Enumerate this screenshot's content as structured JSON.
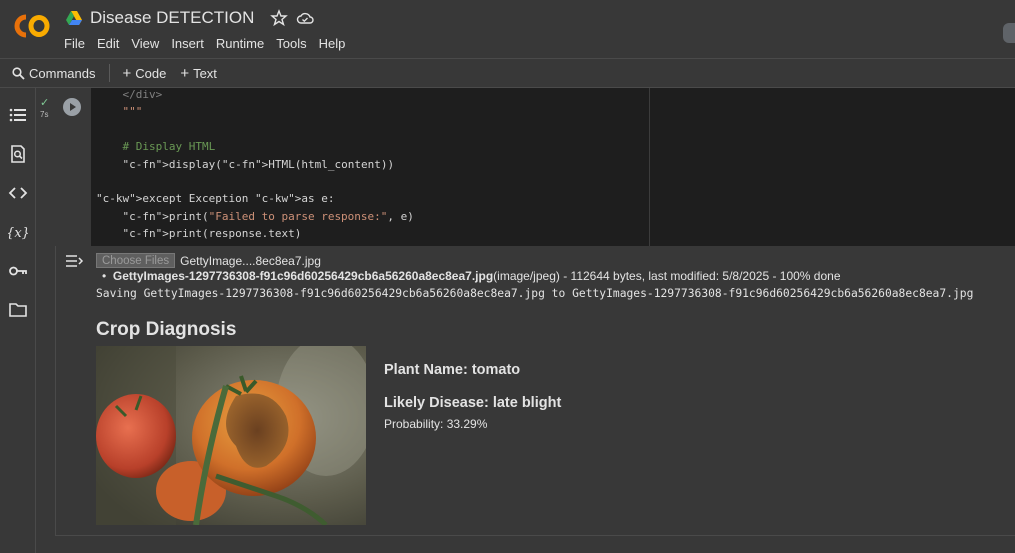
{
  "app": {
    "logo_text": "CO",
    "title": "Disease DETECTION"
  },
  "menu": [
    "File",
    "Edit",
    "View",
    "Insert",
    "Runtime",
    "Tools",
    "Help"
  ],
  "toolbar": {
    "commands": "Commands",
    "code": "Code",
    "text": "Text"
  },
  "rail_icons": [
    "table-of-contents-icon",
    "find-icon",
    "code-snippets-icon",
    "variables-icon",
    "secrets-key-icon",
    "files-folder-icon"
  ],
  "cell": {
    "status": "✓",
    "exec_time": "7s",
    "code_lines": [
      "    </div>",
      "    \"\"\"",
      "",
      "    # Display HTML",
      "    display(HTML(html_content))",
      "",
      "except Exception as e:",
      "    print(\"Failed to parse response:\", e)",
      "    print(response.text)"
    ]
  },
  "output": {
    "choose_files": "Choose Files",
    "file_short": "GettyImage....8ec8ea7.jpg",
    "file_name": "GettyImages-1297736308-f91c96d60256429cb6a56260a8ec8ea7.jpg",
    "file_meta": "(image/jpeg) - 112644 bytes, last modified: 5/8/2025 - 100% done",
    "saving_line": "Saving GettyImages-1297736308-f91c96d60256429cb6a56260a8ec8ea7.jpg to GettyImages-1297736308-f91c96d60256429cb6a56260a8ec8ea7.jpg",
    "heading": "Crop Diagnosis",
    "plant_name": "Plant Name: tomato",
    "likely_disease": "Likely Disease: late blight",
    "probability": "Probability: 33.29%"
  },
  "colors": {
    "bg": "#383838",
    "code_bg": "#1e1e1e",
    "logo_orange": "#f9ab00",
    "success": "#81c995"
  }
}
